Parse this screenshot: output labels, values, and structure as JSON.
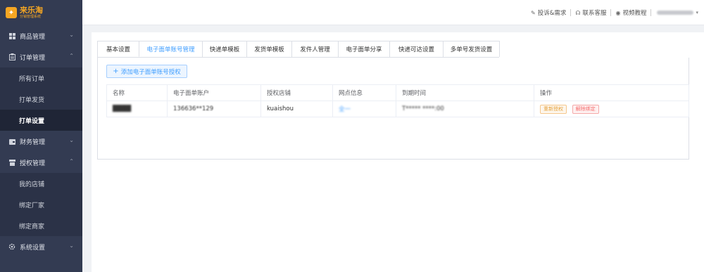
{
  "app": {
    "logo_char": "✦",
    "title": "来乐淘",
    "subtitle": "分销管理系统"
  },
  "sidebar": {
    "groups": [
      {
        "label": "商品管理",
        "icon": "grid-icon",
        "expanded": false,
        "items": []
      },
      {
        "label": "订单管理",
        "icon": "clipboard-icon",
        "expanded": true,
        "items": [
          "所有订单",
          "打单发货",
          "打单设置"
        ]
      },
      {
        "label": "财务管理",
        "icon": "wallet-icon",
        "expanded": false,
        "items": []
      },
      {
        "label": "授权管理",
        "icon": "shop-icon",
        "expanded": true,
        "items": [
          "我的店铺",
          "绑定厂家",
          "绑定商家"
        ]
      },
      {
        "label": "系统设置",
        "icon": "gear-icon",
        "expanded": false,
        "items": []
      }
    ],
    "active_item": "打单设置"
  },
  "header": {
    "links": [
      {
        "label": "投诉&需求",
        "icon": "edit-icon"
      },
      {
        "label": "联系客服",
        "icon": "headset-icon"
      },
      {
        "label": "视频教程",
        "icon": "play-icon"
      }
    ]
  },
  "tabs": [
    "基本设置",
    "电子面单账号管理",
    "快递单模板",
    "发货单模板",
    "发件人管理",
    "电子面单分享",
    "快递可达设置",
    "多单号发货设置"
  ],
  "active_tab": "电子面单账号管理",
  "add_button": "添加电子面单账号授权",
  "table": {
    "headers": [
      "名称",
      "电子面单账户",
      "授权店铺",
      "网点信息",
      "到期时间",
      "操作"
    ],
    "rows": [
      {
        "name": "████",
        "account": "136636**129",
        "shop": "kuaishou",
        "outlet": "全一",
        "expire": "T***** ****:00",
        "actions": [
          "重新授权",
          "解除绑定"
        ]
      }
    ]
  },
  "colors": {
    "sidebar_bg": "#333b52",
    "accent": "#409eff",
    "logo": "#f5a623"
  }
}
